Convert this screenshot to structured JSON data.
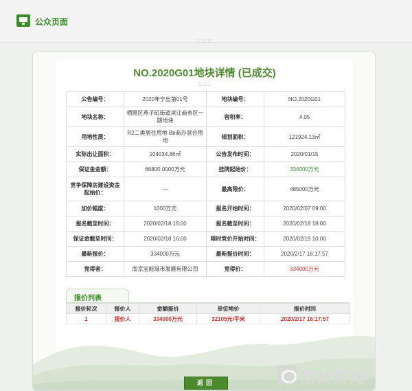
{
  "header": {
    "title": "公众页面",
    "dots": "□□□"
  },
  "page": {
    "heading": "NO.2020G01地块详情 (已成交)",
    "dots": "□□□"
  },
  "info": {
    "notice_no_label": "公告编号：",
    "notice_no": "2020年宁出第01号",
    "plot_no_label": "地块编号：",
    "plot_no": "NO.2020G01",
    "plot_name_label": "地块名称：",
    "plot_name": "栖霞区燕子矶街道滨江商务区一期地块",
    "plot_ratio_label": "容积率：",
    "plot_ratio": "4.05",
    "land_use_label": "用地性质：",
    "land_use": "R2二类居住用地 Bb商办混合用地",
    "planned_area_label": "规划面积：",
    "planned_area": "121924.13㎡",
    "transfer_area_label": "实际出让面积：",
    "transfer_area": "104034.86㎡",
    "announce_time_label": "公告发布时间：",
    "announce_time": "2020/01/15",
    "deposit_label": "保证金金额：",
    "deposit": "66800.0000万元",
    "start_price_label": "挂牌起始价：",
    "start_price": "334000万元",
    "housing_fund_label": "竞争保障房建设资金起始价：",
    "housing_fund": "---",
    "max_price_label": "最高限价：",
    "max_price": "485000万元",
    "increment_label": "加价幅度：",
    "increment": "1000万元",
    "reg_start_label": "报名开始时间：",
    "reg_start": "2020/02/07 09:00",
    "reg_deadline_label": "报名截至时间：",
    "reg_deadline": "2020/02/18 16:00",
    "reg_end_label": "报名截至时间：",
    "reg_end": "2020/02/18 18:00",
    "deposit_deadline_label": "保证金截至时间：",
    "deposit_deadline": "2020/02/18 16:00",
    "limit_bid_start_label": "限时竞价开始时间：",
    "limit_bid_start": "2020/02/19 10:00",
    "latest_price_label": "最新报价：",
    "latest_price": "334000万元",
    "latest_time_label": "最新报价时间：",
    "latest_time": "2020/2/17 16:17:57",
    "winner_label": "竞得者：",
    "winner": "南京宝能城市发展有限公司",
    "winning_price_label": "竞得价：",
    "winning_price": "334000万元"
  },
  "bids": {
    "tab_label": "报价列表",
    "headers": [
      "报价轮次",
      "报价人",
      "金额报价",
      "单位地价",
      "报价时间"
    ],
    "rows": [
      {
        "round": "1",
        "bidder": "报价人",
        "amount": "334000万元",
        "unit_price": "32105元/平米",
        "time": "2020/2/17 16:17:57"
      }
    ]
  },
  "back_button": "返回",
  "watermark": "荔枝新闻",
  "colors": {
    "brand_green": "#3c8c2a",
    "highlight_red": "#e03030",
    "heading_green": "#4d8a2e"
  }
}
